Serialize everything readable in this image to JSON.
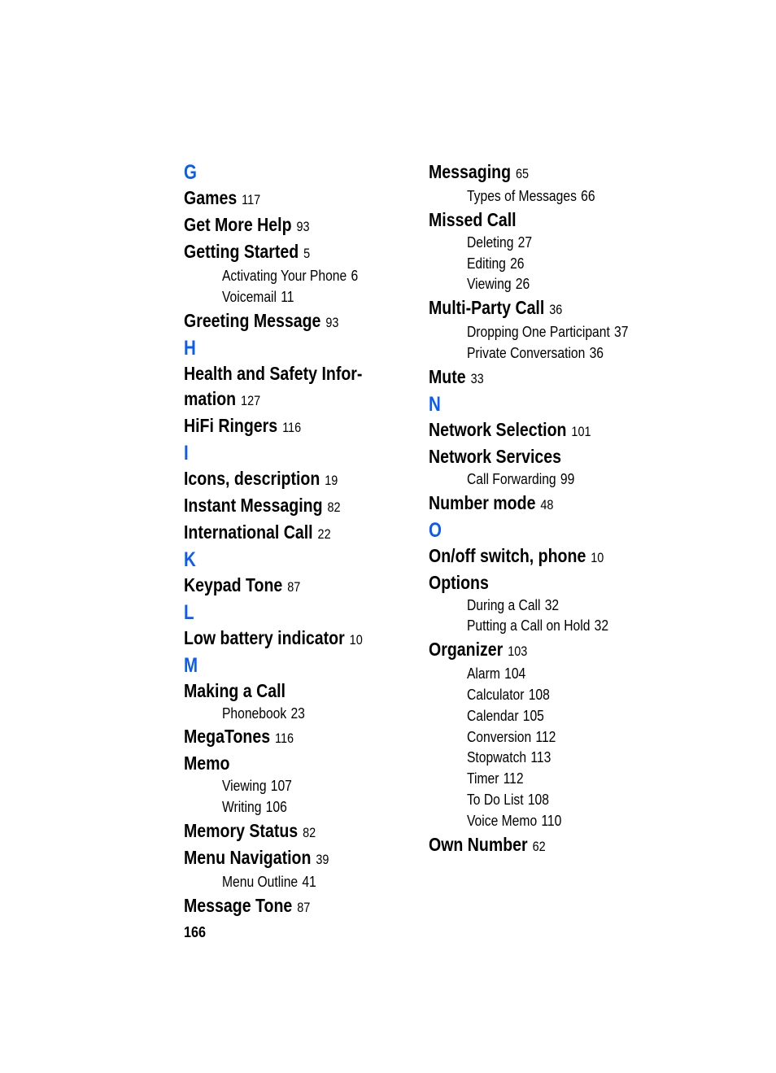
{
  "page_number": "166",
  "accent_color": "#0a5cf5",
  "left_column": [
    {
      "type": "letter",
      "text": "G"
    },
    {
      "type": "entry",
      "text": "Games",
      "page": "117"
    },
    {
      "type": "entry",
      "text": "Get More Help",
      "page": "93"
    },
    {
      "type": "entry",
      "text": "Getting Started",
      "page": "5"
    },
    {
      "type": "sub",
      "text": "Activating Your Phone",
      "page": "6"
    },
    {
      "type": "sub",
      "text": "Voicemail",
      "page": "11"
    },
    {
      "type": "entry",
      "text": "Greeting Message",
      "page": "93"
    },
    {
      "type": "letter",
      "text": "H"
    },
    {
      "type": "entry",
      "text": "Health and Safety Infor-mation",
      "page": "127",
      "wrap": true
    },
    {
      "type": "entry",
      "text": "HiFi Ringers",
      "page": "116"
    },
    {
      "type": "letter",
      "text": "I"
    },
    {
      "type": "entry",
      "text": "Icons, description",
      "page": "19"
    },
    {
      "type": "entry",
      "text": "Instant Messaging",
      "page": "82"
    },
    {
      "type": "entry",
      "text": "International Call",
      "page": "22"
    },
    {
      "type": "letter",
      "text": "K"
    },
    {
      "type": "entry",
      "text": "Keypad Tone",
      "page": "87"
    },
    {
      "type": "letter",
      "text": "L"
    },
    {
      "type": "entry",
      "text": "Low battery indicator",
      "page": "10"
    },
    {
      "type": "letter",
      "text": "M"
    },
    {
      "type": "entry",
      "text": "Making a Call",
      "page": ""
    },
    {
      "type": "sub",
      "text": "Phonebook",
      "page": "23"
    },
    {
      "type": "entry",
      "text": "MegaTones",
      "page": "116"
    },
    {
      "type": "entry",
      "text": "Memo",
      "page": ""
    },
    {
      "type": "sub",
      "text": "Viewing",
      "page": "107"
    },
    {
      "type": "sub",
      "text": "Writing",
      "page": "106"
    },
    {
      "type": "entry",
      "text": "Memory Status",
      "page": "82"
    },
    {
      "type": "entry",
      "text": "Menu Navigation",
      "page": "39"
    },
    {
      "type": "sub",
      "text": "Menu Outline",
      "page": "41"
    },
    {
      "type": "entry",
      "text": "Message Tone",
      "page": "87"
    }
  ],
  "right_column": [
    {
      "type": "entry",
      "text": "Messaging",
      "page": "65"
    },
    {
      "type": "sub",
      "text": "Types of Messages",
      "page": "66"
    },
    {
      "type": "entry",
      "text": "Missed Call",
      "page": ""
    },
    {
      "type": "sub",
      "text": "Deleting",
      "page": "27"
    },
    {
      "type": "sub",
      "text": "Editing",
      "page": "26"
    },
    {
      "type": "sub",
      "text": "Viewing",
      "page": "26"
    },
    {
      "type": "entry",
      "text": "Multi-Party Call",
      "page": "36"
    },
    {
      "type": "sub",
      "text": "Dropping One Participant",
      "page": "37",
      "wrap": true
    },
    {
      "type": "sub",
      "text": "Private Conversation",
      "page": "36"
    },
    {
      "type": "entry",
      "text": "Mute",
      "page": "33"
    },
    {
      "type": "letter",
      "text": "N"
    },
    {
      "type": "entry",
      "text": "Network Selection",
      "page": "101"
    },
    {
      "type": "entry",
      "text": "Network Services",
      "page": ""
    },
    {
      "type": "sub",
      "text": "Call Forwarding",
      "page": "99"
    },
    {
      "type": "entry",
      "text": "Number mode",
      "page": "48"
    },
    {
      "type": "letter",
      "text": "O"
    },
    {
      "type": "entry",
      "text": "On/off switch, phone",
      "page": "10"
    },
    {
      "type": "entry",
      "text": "Options",
      "page": ""
    },
    {
      "type": "sub",
      "text": "During a Call",
      "page": "32"
    },
    {
      "type": "sub",
      "text": "Putting a Call on Hold",
      "page": "32"
    },
    {
      "type": "entry",
      "text": "Organizer",
      "page": "103"
    },
    {
      "type": "sub",
      "text": "Alarm",
      "page": "104"
    },
    {
      "type": "sub",
      "text": "Calculator",
      "page": "108"
    },
    {
      "type": "sub",
      "text": "Calendar",
      "page": "105"
    },
    {
      "type": "sub",
      "text": "Conversion",
      "page": "112"
    },
    {
      "type": "sub",
      "text": "Stopwatch",
      "page": "113"
    },
    {
      "type": "sub",
      "text": "Timer",
      "page": "112"
    },
    {
      "type": "sub",
      "text": "To Do List",
      "page": "108"
    },
    {
      "type": "sub",
      "text": "Voice Memo",
      "page": "110"
    },
    {
      "type": "entry",
      "text": "Own Number",
      "page": "62"
    }
  ]
}
